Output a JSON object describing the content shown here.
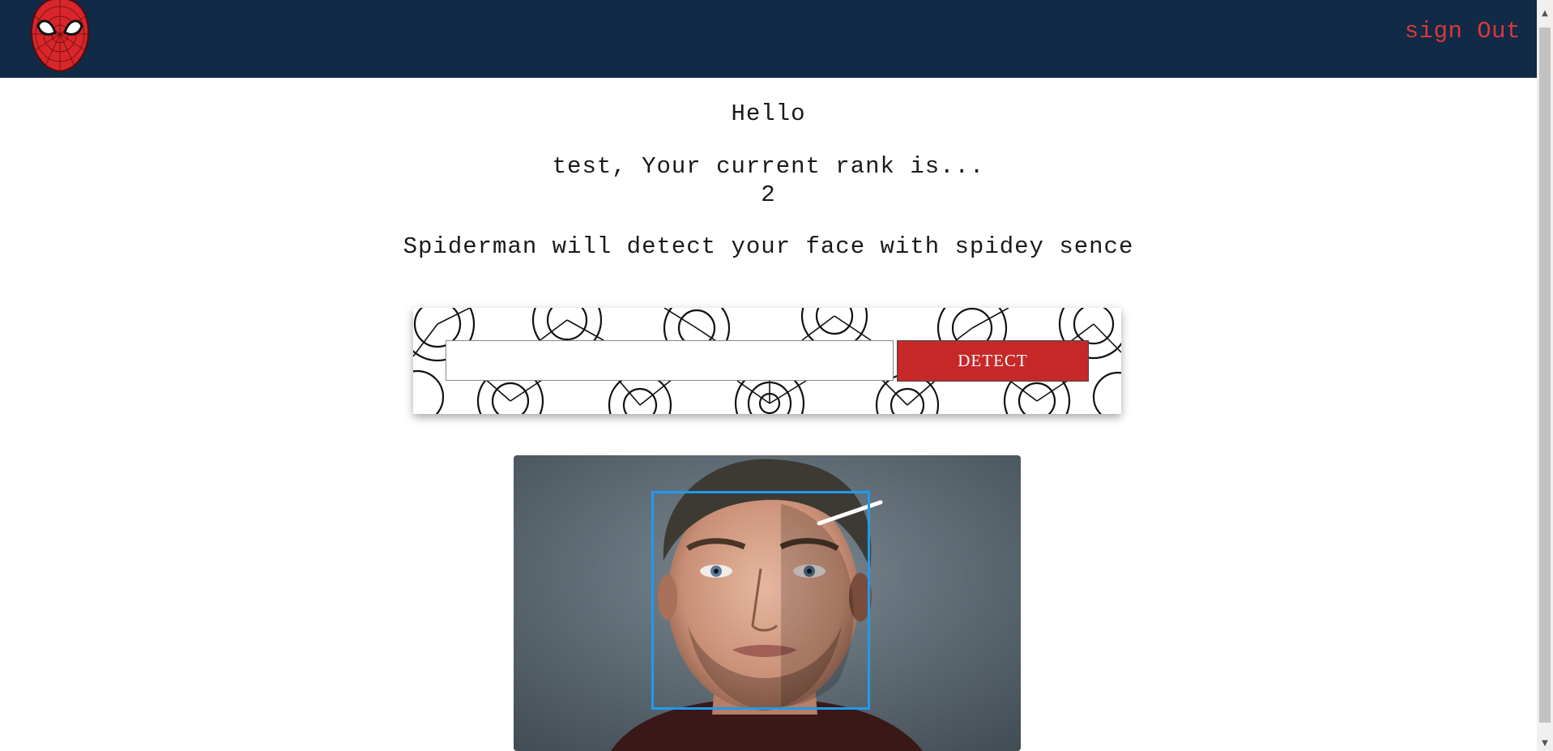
{
  "header": {
    "logo_name": "spiderman-mask-logo",
    "signout_label": "sign Out",
    "signout_color": "#d9393a",
    "background_color": "#102a47"
  },
  "greeting": {
    "hello": "Hello",
    "rank_line": "test, Your current rank is...",
    "rank_value": "2",
    "tagline": "Spiderman will detect your face with spidey sence"
  },
  "form": {
    "input_value": "",
    "input_placeholder": "",
    "detect_label": "DETECT",
    "detect_color": "#c62828"
  },
  "result": {
    "face_box_color": "#1e9bf0"
  }
}
